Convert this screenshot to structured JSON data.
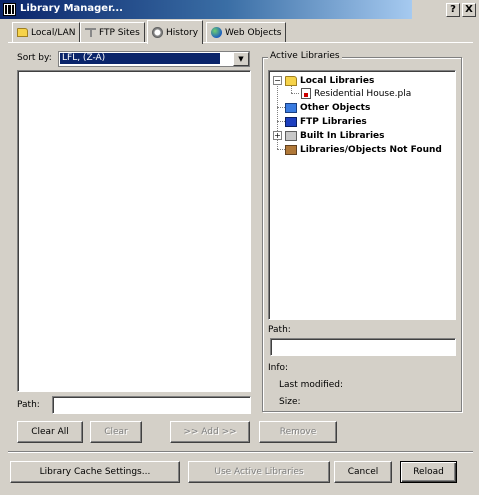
{
  "window": {
    "title": "Library Manager...",
    "help_label": "?",
    "close_label": "X"
  },
  "tabs": [
    {
      "label": "Local/LAN",
      "icon": "folder-icon"
    },
    {
      "label": "FTP Sites",
      "icon": "ftp-icon"
    },
    {
      "label": "History",
      "icon": "history-icon",
      "active": true
    },
    {
      "label": "Web Objects",
      "icon": "globe-icon"
    }
  ],
  "left_panel": {
    "sort_label": "Sort by:",
    "sort_value": "LFL, (Z-A)",
    "path_label": "Path:",
    "path_value": ""
  },
  "active_libraries": {
    "title": "Active Libraries",
    "tree": [
      {
        "label": "Local Libraries",
        "icon": "folder-icon"
      },
      {
        "label": "Residential House.pla",
        "icon": "library-file-icon"
      },
      {
        "label": "Other Objects",
        "icon": "other-objects-icon"
      },
      {
        "label": "FTP Libraries",
        "icon": "ftp-library-icon"
      },
      {
        "label": "Built In Libraries",
        "icon": "builtin-library-icon"
      },
      {
        "label": "Libraries/Objects Not Found",
        "icon": "not-found-icon"
      }
    ],
    "path_label": "Path:",
    "info_label": "Info:",
    "last_modified_label": "Last modified:",
    "size_label": "Size:"
  },
  "middle_buttons": {
    "clear_all": "Clear All",
    "clear": "Clear",
    "add": ">> Add >>",
    "remove": "Remove"
  },
  "bottom_buttons": {
    "cache_settings": "Library Cache Settings...",
    "use_active": "Use Active Libraries",
    "cancel": "Cancel",
    "reload": "Reload"
  }
}
